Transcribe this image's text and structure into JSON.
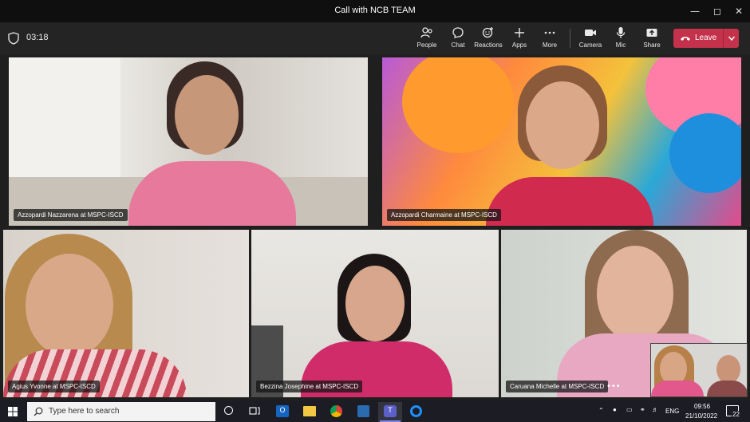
{
  "window": {
    "title": "Call with NCB TEAM"
  },
  "meeting": {
    "timer": "03:18"
  },
  "toolbar": {
    "people": "People",
    "chat": "Chat",
    "reactions": "Reactions",
    "apps": "Apps",
    "more": "More",
    "camera": "Camera",
    "mic": "Mic",
    "share": "Share",
    "leave": "Leave"
  },
  "participants": [
    {
      "name": "Azzopardi Nazzarena at MSPC-ISCD"
    },
    {
      "name": "Azzopardi Charmaine at MSPC-ISCD"
    },
    {
      "name": "Agius Yvonne at MSPC-ISCD"
    },
    {
      "name": "Bezzina Josephine at MSPC-ISCD"
    },
    {
      "name": "Caruana Michelle at MSPC-ISCD"
    }
  ],
  "taskbar": {
    "search_placeholder": "Type here to search",
    "language": "ENG",
    "time": "09:56",
    "date": "21/10/2022",
    "notifications": "22"
  },
  "colors": {
    "leave": "#c4314b",
    "accent": "#6264a7"
  }
}
